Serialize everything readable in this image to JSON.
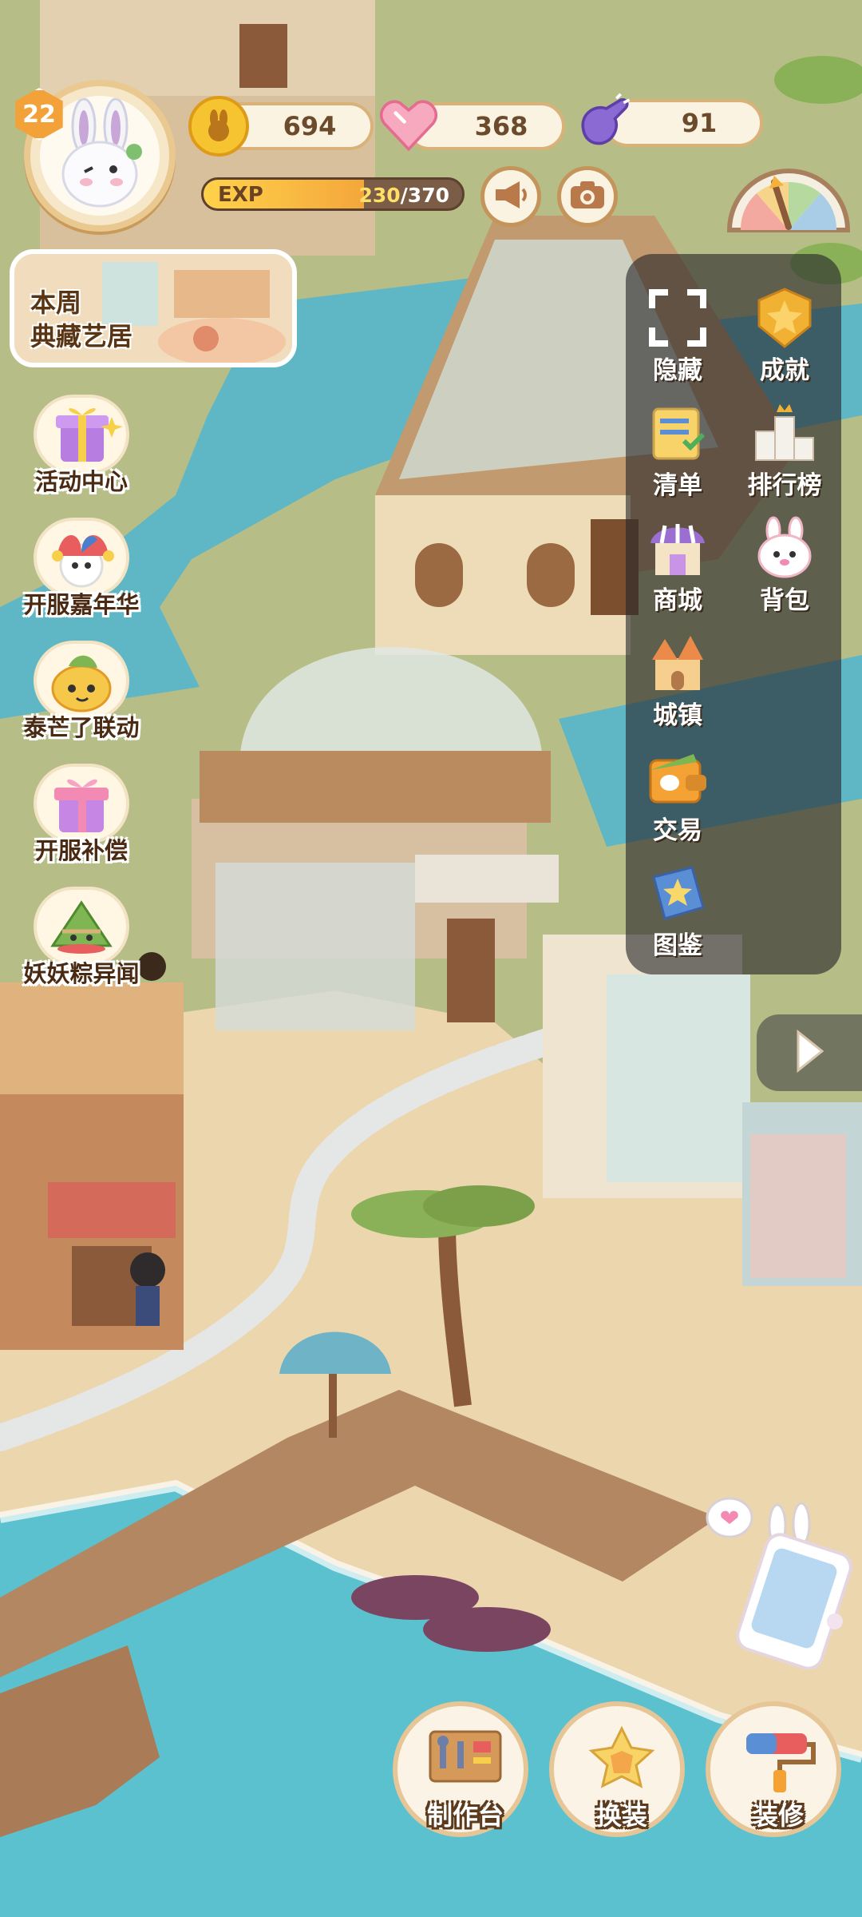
{
  "player": {
    "level": "22",
    "avatar_icon": "bunny-avatar-icon"
  },
  "resources": {
    "coins": "694",
    "hearts": "368",
    "energy": "91"
  },
  "exp": {
    "label": "EXP",
    "current": "230",
    "max": "/370",
    "fraction": 0.62
  },
  "weekly_banner": {
    "line1": "本周",
    "line2": "典藏艺居"
  },
  "events": [
    {
      "label": "活动中心",
      "icon": "gift-box-icon"
    },
    {
      "label": "开服嘉年华",
      "icon": "jester-hat-icon"
    },
    {
      "label": "泰芒了联动",
      "icon": "mango-character-icon"
    },
    {
      "label": "开服补偿",
      "icon": "pink-gift-icon"
    },
    {
      "label": "妖妖粽异闻",
      "icon": "zongzi-icon"
    }
  ],
  "menu": [
    {
      "label": "隐藏",
      "icon": "hide-frame-icon"
    },
    {
      "label": "成就",
      "icon": "star-badge-icon"
    },
    {
      "label": "清单",
      "icon": "checklist-icon"
    },
    {
      "label": "排行榜",
      "icon": "podium-icon"
    },
    {
      "label": "商城",
      "icon": "shop-icon"
    },
    {
      "label": "背包",
      "icon": "bunny-bag-icon"
    },
    {
      "label": "城镇",
      "icon": "castle-icon"
    },
    {
      "label": "交易",
      "icon": "trade-wallet-icon"
    },
    {
      "label": "图鉴",
      "icon": "star-book-icon"
    }
  ],
  "actions": [
    {
      "label": "制作台",
      "icon": "workbench-icon"
    },
    {
      "label": "换装",
      "icon": "outfit-star-icon"
    },
    {
      "label": "装修",
      "icon": "paint-roller-icon"
    }
  ],
  "colors": {
    "grass": "#b7bd87",
    "water": "#5fb6c4",
    "sand": "#ecd6ae",
    "wood": "#a9805e",
    "panel": "#26262a"
  }
}
